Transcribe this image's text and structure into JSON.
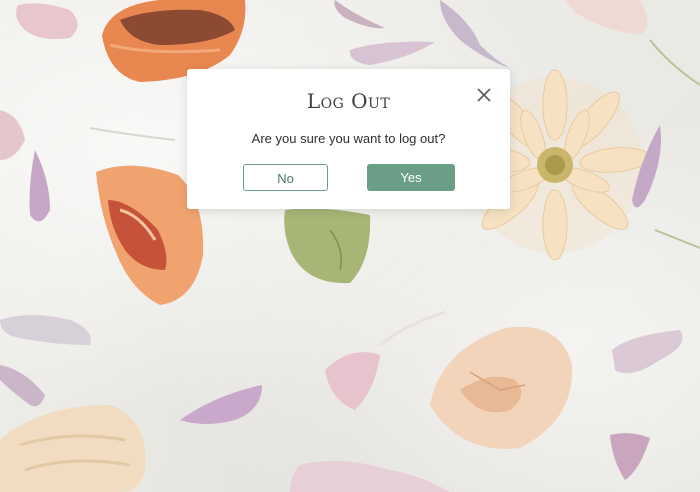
{
  "dialog": {
    "title": "Log Out",
    "message": "Are you sure you want to log out?",
    "close_icon": "close-icon",
    "no_label": "No",
    "yes_label": "Yes",
    "accent_color": "#6b9e86"
  },
  "background": {
    "description_icon": "macaron-and-petals-photo"
  }
}
